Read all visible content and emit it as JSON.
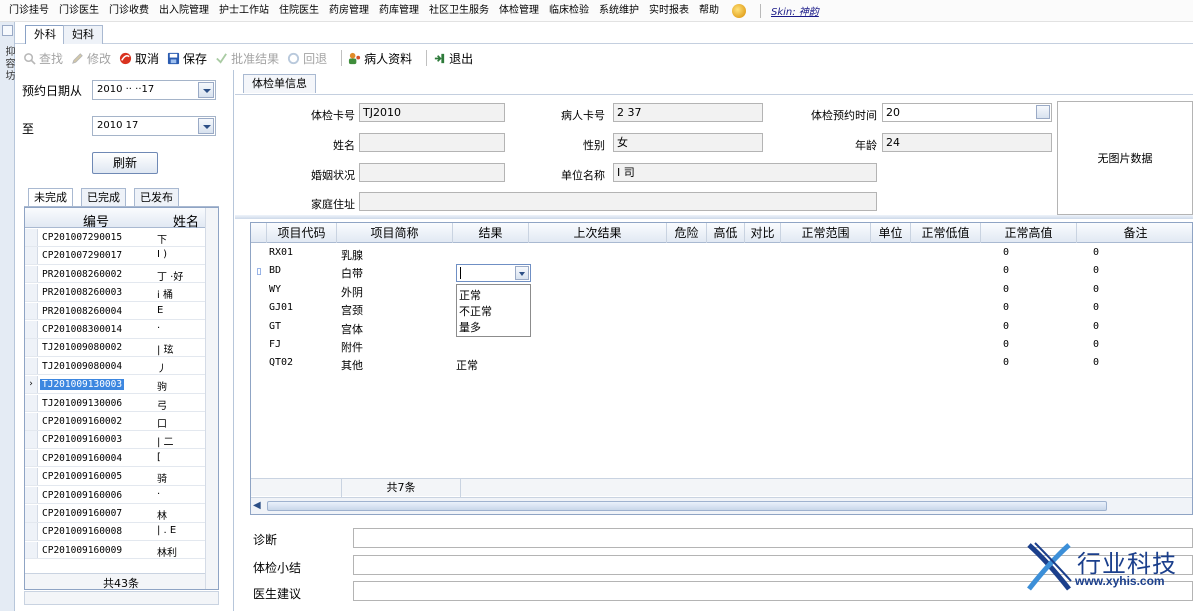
{
  "menubar": {
    "items": [
      "门诊挂号",
      "门诊医生",
      "门诊收费",
      "出入院管理",
      "护士工作站",
      "住院医生",
      "药房管理",
      "药库管理",
      "社区卫生服务",
      "体检管理",
      "临床检验",
      "系统维护",
      "实时报表",
      "帮助"
    ],
    "skin_label": "Skin: 神韵"
  },
  "sidestrip": {
    "text1": "抑",
    "text2": "容",
    "text3": "坊"
  },
  "dept_tabs": [
    {
      "label": "外科",
      "active": true
    },
    {
      "label": "妇科",
      "active": false
    }
  ],
  "toolbar": {
    "find": "查找",
    "edit": "修改",
    "cancel": "取消",
    "save": "保存",
    "approve": "批准结果",
    "revert": "回退",
    "patient": "病人资料",
    "exit": "退出"
  },
  "left": {
    "date_from_label": "预约日期从",
    "date_from_value": "2010 ·· ··17",
    "date_to_label": "至",
    "date_to_value": "2010     17",
    "refresh_label": "刷新",
    "subtabs": [
      "未完成",
      "已完成",
      "已发布"
    ],
    "grid_headers": {
      "code": "编号",
      "name": "姓名"
    },
    "rows": [
      {
        "code": "CP201007290015",
        "name": "下"
      },
      {
        "code": "CP201007290017",
        "name": "I )"
      },
      {
        "code": "PR201008260002",
        "name": "丁 ·好"
      },
      {
        "code": "PR201008260003",
        "name": "i     桶"
      },
      {
        "code": "PR201008260004",
        "name": "      E"
      },
      {
        "code": "CP201008300014",
        "name": "·"
      },
      {
        "code": "TJ201009080002",
        "name": "|     玹"
      },
      {
        "code": "TJ201009080004",
        "name": "丿"
      },
      {
        "code": "TJ201009130003",
        "name": "      驹"
      },
      {
        "code": "TJ201009130006",
        "name": "      弓"
      },
      {
        "code": "CP201009160002",
        "name": "      口"
      },
      {
        "code": "CP201009160003",
        "name": "|     二"
      },
      {
        "code": "CP201009160004",
        "name": "      ["
      },
      {
        "code": "CP201009160005",
        "name": "      骑"
      },
      {
        "code": "CP201009160006",
        "name": "·"
      },
      {
        "code": "CP201009160007",
        "name": "      林"
      },
      {
        "code": "CP201009160008",
        "name": "|  .  E"
      },
      {
        "code": "CP201009160009",
        "name": "林利"
      }
    ],
    "selected_index": 8,
    "footer": "共43条"
  },
  "right": {
    "tab_label": "体检单信息",
    "form": {
      "card_no_label": "体检卡号",
      "card_no_value": "TJ2010",
      "patient_card_label": "病人卡号",
      "patient_card_value": "2              37",
      "appt_time_label": "体检预约时间",
      "appt_time_value": "20",
      "name_label": "姓名",
      "name_value": "",
      "gender_label": "性别",
      "gender_value": "女",
      "age_label": "年龄",
      "age_value": "24",
      "marital_label": "婚姻状况",
      "marital_value": "",
      "unit_label": "单位名称",
      "unit_value": "I               司",
      "address_label": "家庭住址",
      "address_value": "",
      "no_image": "无图片数据"
    },
    "grid": {
      "headers": [
        "项目代码",
        "项目简称",
        "结果",
        "上次结果",
        "危险",
        "高低",
        "对比",
        "正常范围",
        "单位",
        "正常低值",
        "正常高值",
        "备注"
      ],
      "rows": [
        {
          "code": "RX01",
          "name": "乳腺",
          "result": "",
          "low": "0",
          "high": "0"
        },
        {
          "code": "BD",
          "name": "白带",
          "result": "",
          "low": "0",
          "high": "0"
        },
        {
          "code": "WY",
          "name": "外阴",
          "result": "",
          "low": "0",
          "high": "0"
        },
        {
          "code": "GJ01",
          "name": "宫颈",
          "result": "",
          "low": "0",
          "high": "0"
        },
        {
          "code": "GT",
          "name": "宫体",
          "result": "",
          "low": "0",
          "high": "0"
        },
        {
          "code": "FJ",
          "name": "附件",
          "result": "",
          "low": "0",
          "high": "0"
        },
        {
          "code": "QT02",
          "name": "其他",
          "result": "正常",
          "low": "0",
          "high": "0"
        }
      ],
      "editing_row": 1,
      "dropdown_options": [
        "正常",
        "不正常",
        "量多"
      ],
      "footer": "共7条"
    },
    "bottom": {
      "diagnosis_label": "诊断",
      "summary_label": "体检小结",
      "advice_label": "医生建议"
    }
  },
  "watermark": {
    "name": "行业科技",
    "url": "www.xyhis.com"
  },
  "colors": {
    "selection": "#3d87e0",
    "accent_blue": "#1b3f8c",
    "grid_border": "#8fa4c4"
  }
}
